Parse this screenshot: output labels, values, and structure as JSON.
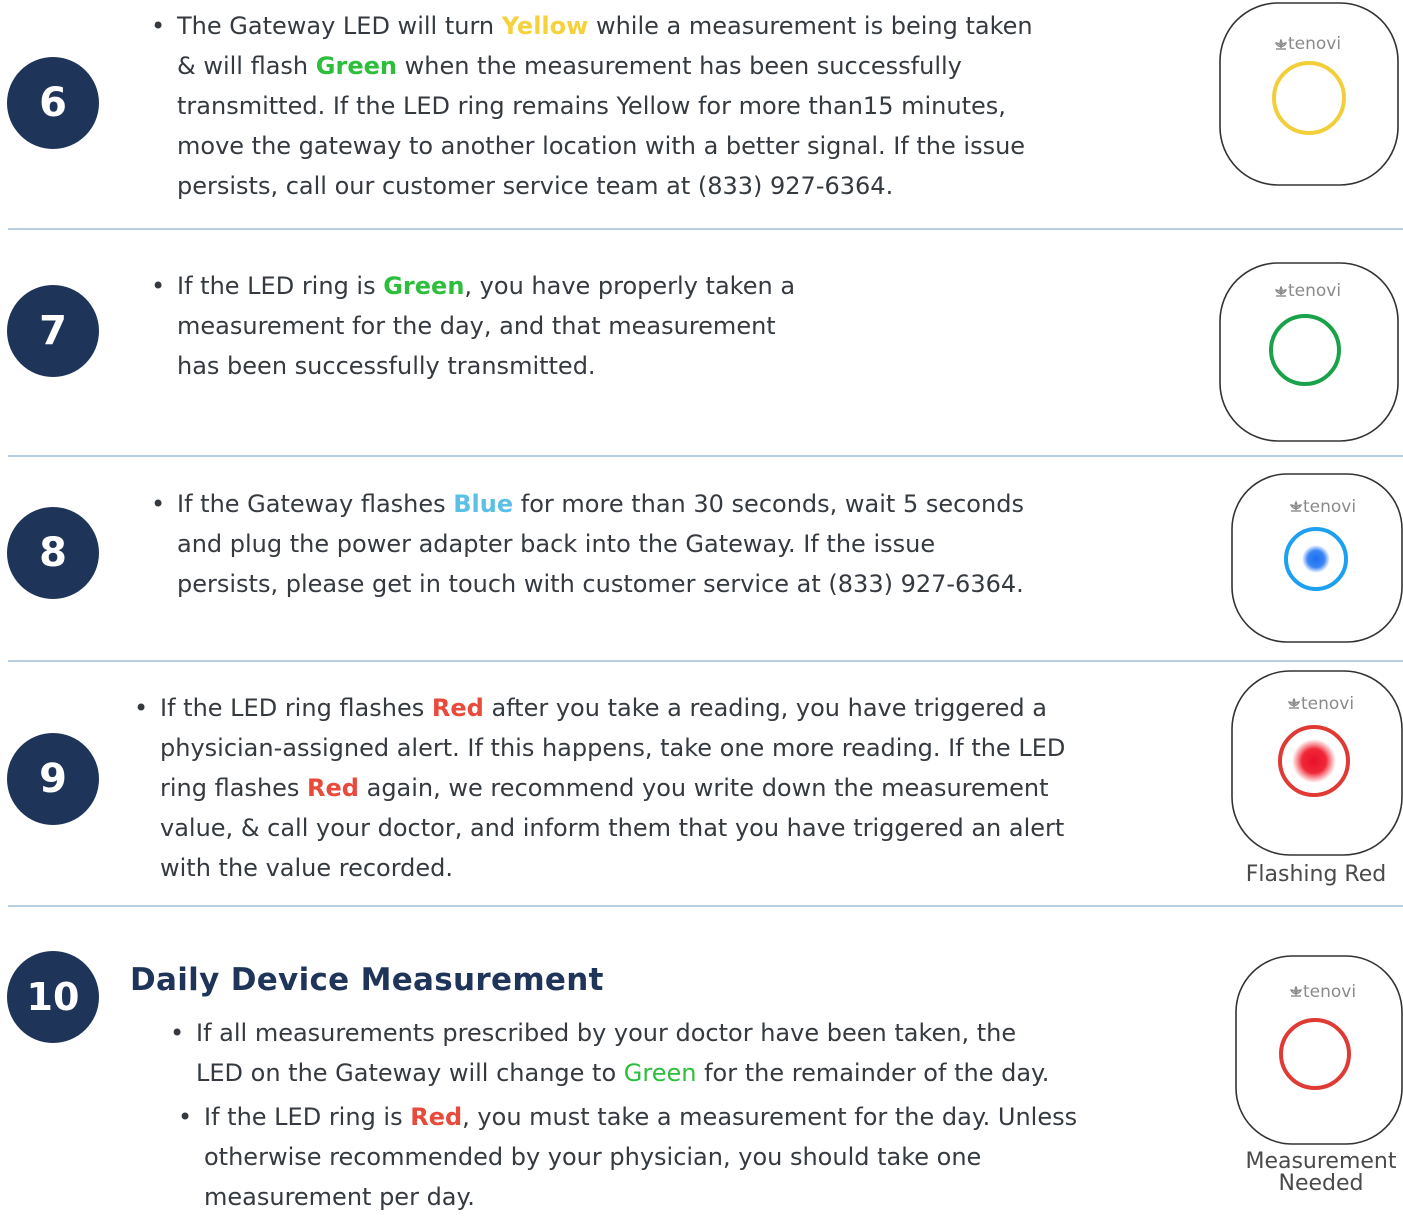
{
  "colors": {
    "badge": "#1f3459",
    "text": "#343a40",
    "yellow": "#f5d23c",
    "green": "#2dbe3c",
    "blue": "#5ac0e6",
    "red": "#e84a3c",
    "rule": "#b7cfe0"
  },
  "device": {
    "brand": "tenovi",
    "logo_icon": "lotus-icon"
  },
  "steps": [
    {
      "number": "6",
      "lines": [
        [
          "The Gateway LED will turn ",
          "Yellow",
          " while a measurement is being taken"
        ],
        [
          "& will flash ",
          "Green",
          " when the measurement has been successfully"
        ],
        [
          "transmitted. If the LED ring remains Yellow for more than15 minutes,"
        ],
        [
          "move the gateway to another location with a better signal. If the issue"
        ],
        [
          "persists, call our customer service team at (833) 927-6364."
        ]
      ]
    },
    {
      "number": "7",
      "lines": [
        [
          "If the LED ring is ",
          "Green",
          ", you have properly taken a"
        ],
        [
          "measurement for the day, and that measurement"
        ],
        [
          "has been successfully transmitted."
        ]
      ]
    },
    {
      "number": "8",
      "lines": [
        [
          "If the Gateway flashes ",
          "Blue",
          " for more than 30 seconds, wait 5 seconds"
        ],
        [
          "and plug the power adapter back into the Gateway. If the issue"
        ],
        [
          "persists, please get in touch with customer service at (833) 927-6364."
        ]
      ]
    },
    {
      "number": "9",
      "lines": [
        [
          "If the LED ring flashes ",
          "Red",
          " after you take a reading, you have triggered a"
        ],
        [
          "physician-assigned alert. If this happens, take one more reading. If the LED"
        ],
        [
          "ring flashes ",
          "Red",
          " again, we recommend you write down the measurement"
        ],
        [
          "value, & call your doctor, and inform them that you have triggered an alert"
        ],
        [
          "with the value recorded."
        ]
      ],
      "caption": "Flashing Red"
    },
    {
      "number": "10",
      "heading": "Daily Device Measurement",
      "bullets": [
        {
          "lines": [
            [
              "If all measurements prescribed by your doctor have been taken, the"
            ],
            [
              "LED on the Gateway will change to ",
              "Green",
              " for the remainder of the day."
            ]
          ]
        },
        {
          "lines": [
            [
              "If the LED ring is ",
              "Red",
              ", you must take a measurement for the day. Unless"
            ],
            [
              "otherwise recommended by your physician, you should take one"
            ],
            [
              "measurement per day."
            ]
          ]
        }
      ],
      "caption": [
        "Measurement",
        "Needed"
      ]
    }
  ]
}
